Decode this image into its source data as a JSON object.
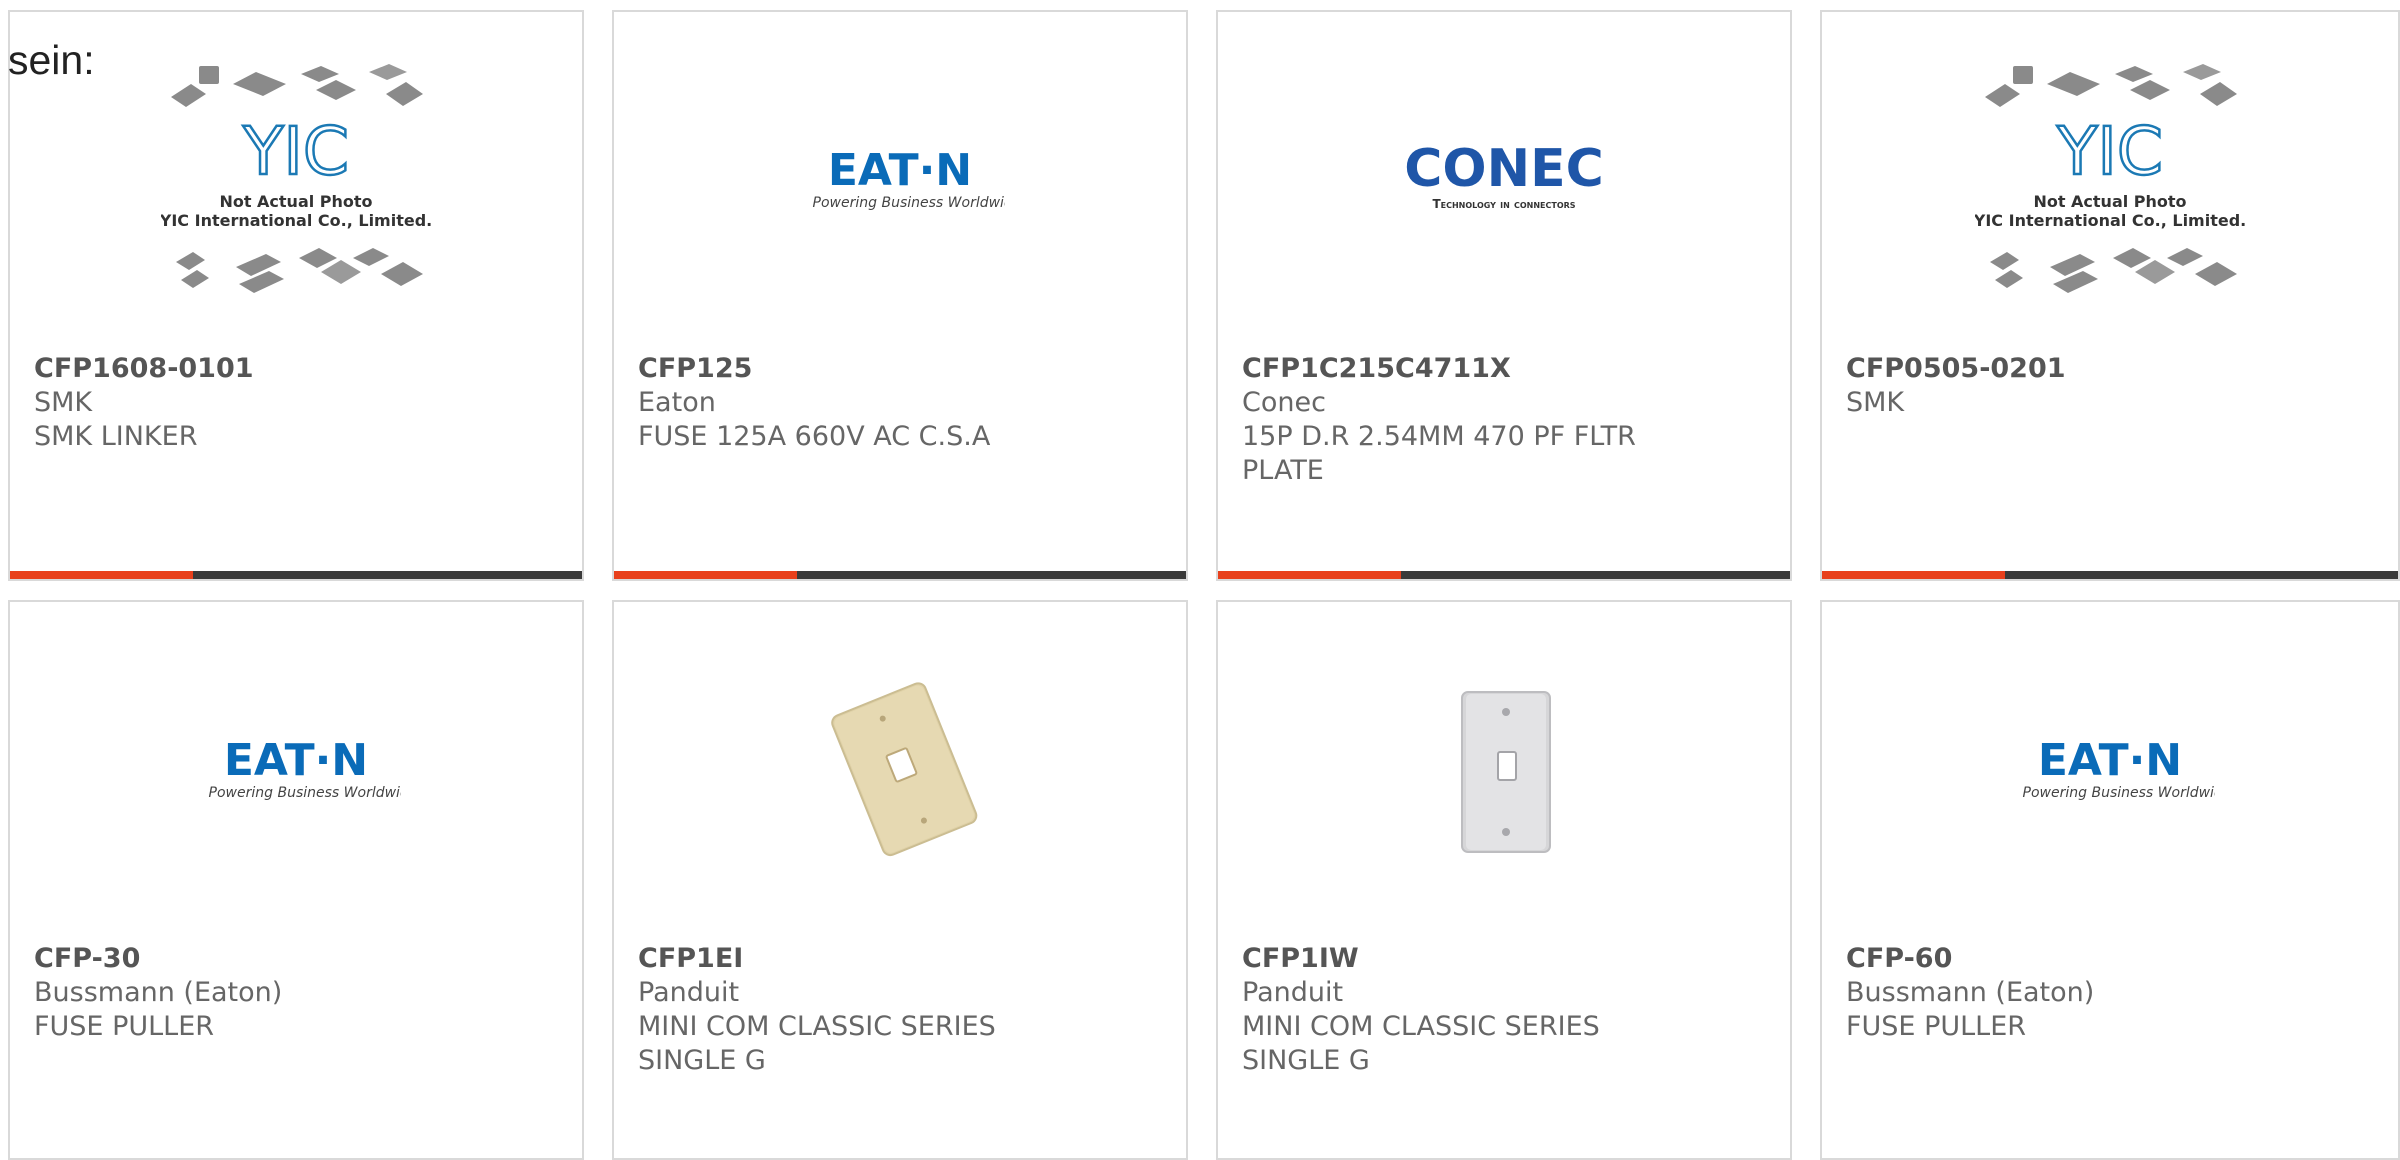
{
  "intro_text": "sein:",
  "colors": {
    "accent": "#e8401c",
    "bar": "#3a3a3a",
    "text": "#666666",
    "title": "#555555"
  },
  "placeholder": {
    "line1": "Not Actual Photo",
    "line2": "YIC International Co., Limited."
  },
  "logos": {
    "eaton": {
      "word": "EAT·N",
      "tagline": "Powering Business Worldwide"
    },
    "conec": {
      "word": "CONEC",
      "tagline": "Technology in connectors"
    }
  },
  "products": [
    {
      "part": "CFP1608-0101",
      "mfr": "SMK",
      "desc": [
        "SMK LINKER"
      ],
      "image": "yic-placeholder"
    },
    {
      "part": "CFP125",
      "mfr": "Eaton",
      "desc": [
        "FUSE 125A 660V AC C.S.A"
      ],
      "image": "eaton-logo"
    },
    {
      "part": "CFP1C215C4711X",
      "mfr": "Conec",
      "desc": [
        "15P D.R 2.54MM 470 PF FLTR",
        "PLATE"
      ],
      "image": "conec-logo"
    },
    {
      "part": "CFP0505-0201",
      "mfr": "SMK",
      "desc": [],
      "image": "yic-placeholder"
    },
    {
      "part": "CFP-30",
      "mfr": "Bussmann (Eaton)",
      "desc": [
        "FUSE PULLER"
      ],
      "image": "eaton-logo"
    },
    {
      "part": "CFP1EI",
      "mfr": "Panduit",
      "desc": [
        "MINI COM CLASSIC SERIES",
        "SINGLE G"
      ],
      "image": "ivory-wall-plate"
    },
    {
      "part": "CFP1IW",
      "mfr": "Panduit",
      "desc": [
        "MINI COM CLASSIC SERIES",
        "SINGLE G"
      ],
      "image": "white-wall-plate"
    },
    {
      "part": "CFP-60",
      "mfr": "Bussmann (Eaton)",
      "desc": [
        "FUSE PULLER"
      ],
      "image": "eaton-logo"
    }
  ]
}
